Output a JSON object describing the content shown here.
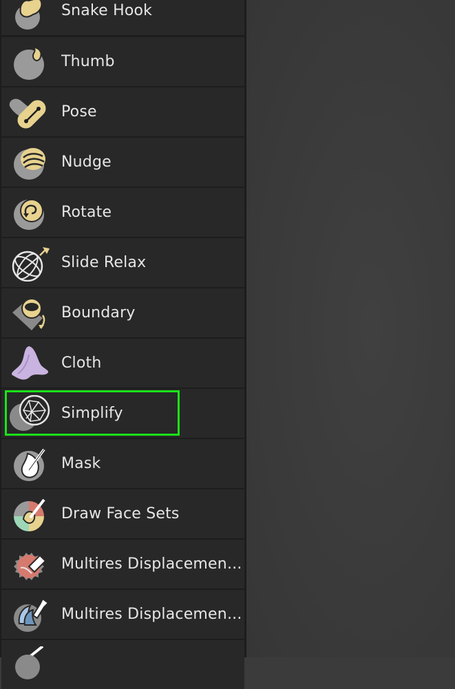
{
  "tools": [
    {
      "label": "Snake Hook",
      "icon": "snake-hook-icon"
    },
    {
      "label": "Thumb",
      "icon": "thumb-icon"
    },
    {
      "label": "Pose",
      "icon": "pose-icon"
    },
    {
      "label": "Nudge",
      "icon": "nudge-icon"
    },
    {
      "label": "Rotate",
      "icon": "rotate-icon"
    },
    {
      "label": "Slide Relax",
      "icon": "slide-relax-icon"
    },
    {
      "label": "Boundary",
      "icon": "boundary-icon"
    },
    {
      "label": "Cloth",
      "icon": "cloth-icon"
    },
    {
      "label": "Simplify",
      "icon": "simplify-icon"
    },
    {
      "label": "Mask",
      "icon": "mask-icon"
    },
    {
      "label": "Draw Face Sets",
      "icon": "draw-face-sets-icon"
    },
    {
      "label": "Multires Displacemen...",
      "icon": "multires-displacement-eraser-icon"
    },
    {
      "label": "Multires Displacemen...",
      "icon": "multires-displacement-smear-icon"
    },
    {
      "label": "",
      "icon": "next-tool-icon"
    }
  ],
  "highlighted_tool": "Simplify",
  "colors": {
    "highlight": "#19e619",
    "item_bg": "#282828",
    "panel_bg": "#1d1d1d",
    "text": "#e6e6e6"
  }
}
